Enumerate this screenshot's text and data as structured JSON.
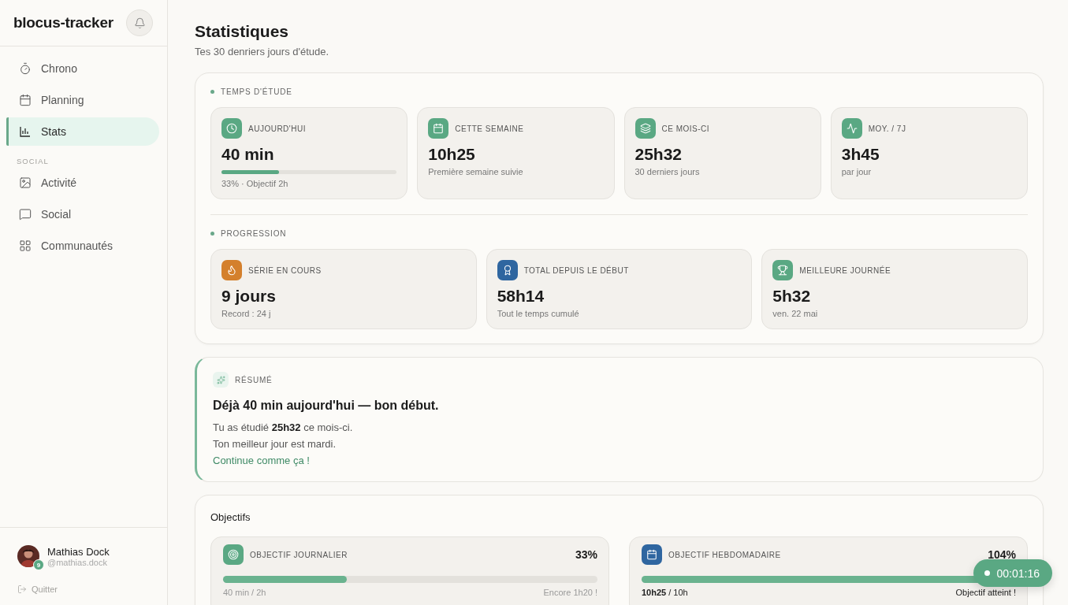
{
  "sidebar": {
    "brand": "blocus-tracker",
    "nav": [
      {
        "label": "Chrono",
        "selected": false
      },
      {
        "label": "Planning",
        "selected": false
      },
      {
        "label": "Stats",
        "selected": true
      }
    ],
    "section_label": "SOCIAL",
    "social_items": [
      {
        "label": "Activité",
        "selected": false
      },
      {
        "label": "Social",
        "selected": false
      },
      {
        "label": "Communautés",
        "selected": false
      }
    ],
    "user": {
      "name": "Mathias Dock",
      "handle": "@mathias.dock",
      "badge": "9"
    },
    "logout": "Quitter"
  },
  "header": {
    "title": "Statistiques",
    "subtitle": "Tes 30 denriers jours d'étude."
  },
  "study_time": {
    "heading": "TEMPS D'ÉTUDE",
    "cards": [
      {
        "kind": "progress",
        "label": "AUJOURD'HUI",
        "value": "40 min",
        "level": 0.33,
        "caption": "33% · Objectif 2h",
        "color": "#5aa883"
      },
      {
        "kind": "plain",
        "label": "CETTE SEMAINE",
        "value": "10h25",
        "caption": "Première semaine suivie",
        "color": "#5aa883"
      },
      {
        "kind": "plain",
        "label": "CE MOIS-CI",
        "value": "25h32",
        "caption": "30 derniers jours",
        "color": "#5aa883"
      },
      {
        "kind": "plain",
        "label": "MOY. / 7J",
        "value": "3h45",
        "caption": "par jour",
        "color": "#5aa883"
      }
    ]
  },
  "progression": {
    "heading": "PROGRESSION",
    "cards": [
      {
        "kind": "plain",
        "label": "SÉRIE EN COURS",
        "value": "9 jours",
        "caption": "Record : 24 j",
        "color": "#d4802c"
      },
      {
        "kind": "plain",
        "label": "TOTAL DEPUIS LE DÉBUT",
        "value": "58h14",
        "caption": "Tout le temps cumulé",
        "color": "#2f66a0"
      },
      {
        "kind": "plain",
        "label": "MEILLEURE JOURNÉE",
        "value": "5h32",
        "caption": "ven. 22 mai",
        "color": "#5aa883"
      }
    ]
  },
  "summary": {
    "label": "RÉSUMÉ",
    "headline": "Déjà 40 min aujourd'hui — bon début.",
    "lines": [
      "Tu as étudié **25h32** ce mois-ci.",
      "Ton meilleur jour est mardi."
    ],
    "closing": "Continue comme ça !"
  },
  "goals": {
    "title": "Objectifs",
    "items": [
      {
        "label": "OBJECTIF JOURNALIER",
        "percent": "33%",
        "level": 0.33,
        "progress": "40 min / 2h",
        "note": "Encore 1h20 !",
        "reached": false,
        "color": "#5aa883"
      },
      {
        "label": "OBJECTIF HEBDOMADAIRE",
        "percent": "104%",
        "level": 1,
        "progress": "**10h25** / 10h",
        "note": "Objectif atteint !",
        "reached": true,
        "color": "#2f66a0"
      }
    ]
  },
  "timer": {
    "time": "00:01:16"
  }
}
